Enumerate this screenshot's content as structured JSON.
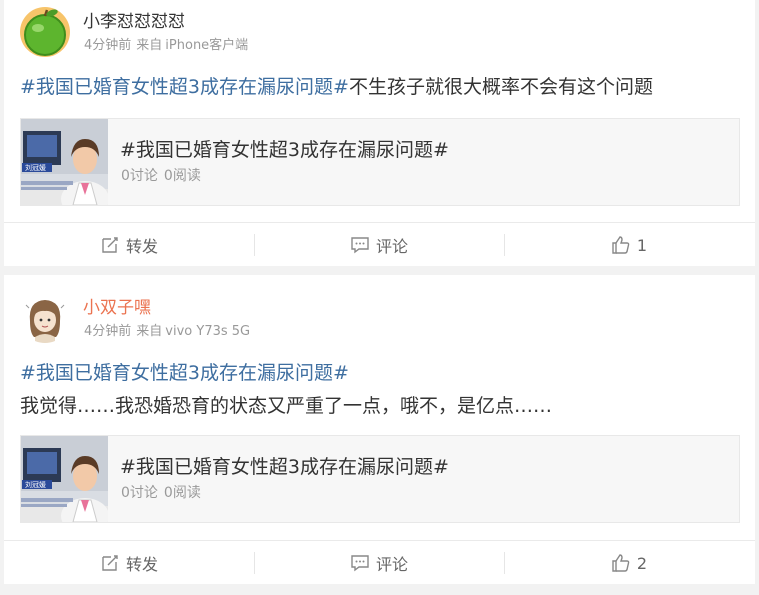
{
  "posts": [
    {
      "author": {
        "name": "小李怼怼怼怼"
      },
      "meta": {
        "time": "4分钟前",
        "source_prefix": "来自",
        "source": "iPhone客户端"
      },
      "content": {
        "topic": "#我国已婚育女性超3成存在漏尿问题#",
        "text": "不生孩子就很大概率不会有这个问题"
      },
      "share": {
        "title": "#我国已婚育女性超3成存在漏尿问题#",
        "discussions": "0讨论",
        "reads": "0阅读",
        "thumb_caption": "刘冠媛"
      },
      "actions": {
        "repost": "转发",
        "comment": "评论",
        "like": "1"
      }
    },
    {
      "author": {
        "name": "小双子嘿"
      },
      "meta": {
        "time": "4分钟前",
        "source_prefix": "来自",
        "source": "vivo Y73s 5G"
      },
      "content": {
        "topic": "#我国已婚育女性超3成存在漏尿问题#",
        "text": "我觉得……我恐婚恐育的状态又严重了一点，哦不，是亿点……"
      },
      "share": {
        "title": "#我国已婚育女性超3成存在漏尿问题#",
        "discussions": "0讨论",
        "reads": "0阅读",
        "thumb_caption": "刘冠媛"
      },
      "actions": {
        "repost": "转发",
        "comment": "评论",
        "like": "2"
      }
    }
  ],
  "colors": {
    "topic": "#3e6ea0",
    "highlight_name": "#eb7350",
    "meta": "#999999",
    "background": "#f2f2f2"
  },
  "icons": {
    "repost": "edit-square-icon",
    "comment": "comment-bubble-icon",
    "like": "thumbs-up-icon"
  }
}
